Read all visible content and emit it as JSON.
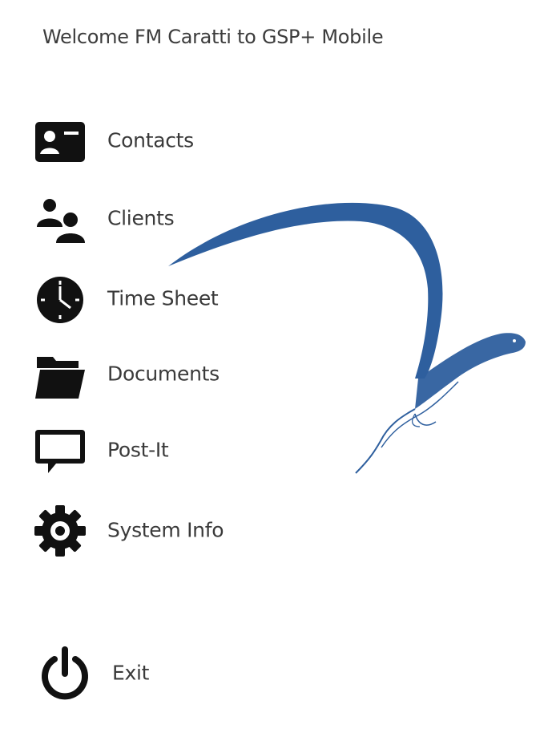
{
  "header": {
    "welcome_text": "Welcome FM Caratti to GSP+ Mobile"
  },
  "brand": {
    "logo_icon": "bird-logo-watermark",
    "logo_color": "#2e5f9e"
  },
  "menu": {
    "items": [
      {
        "label": "Contacts",
        "icon": "contact-card-icon"
      },
      {
        "label": "Clients",
        "icon": "users-icon"
      },
      {
        "label": "Time Sheet",
        "icon": "clock-icon"
      },
      {
        "label": "Documents",
        "icon": "folder-open-icon"
      },
      {
        "label": "Post-It",
        "icon": "speech-bubble-icon"
      },
      {
        "label": "System Info",
        "icon": "gear-icon"
      }
    ],
    "exit": {
      "label": "Exit",
      "icon": "power-icon"
    }
  }
}
